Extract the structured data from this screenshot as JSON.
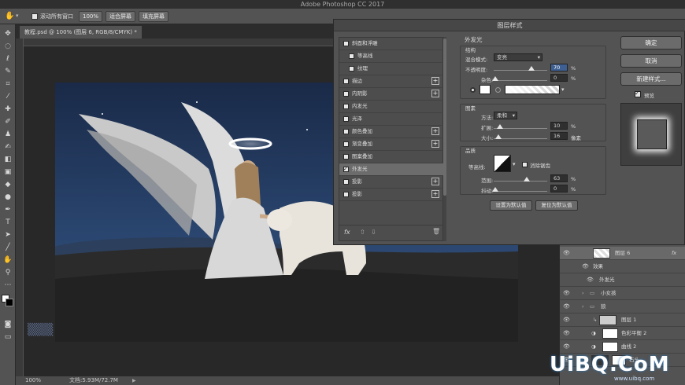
{
  "app": {
    "title": "Adobe Photoshop CC 2017"
  },
  "options_bar": {
    "scroll_all_windows": "滚动所有窗口",
    "zoom_100": "100%",
    "fit_screen": "适合屏幕",
    "fill_screen": "填充屏幕"
  },
  "document": {
    "tab_title": "教程.psd @ 100% (图层 6, RGB/8/CMYK) *",
    "zoom": "100%",
    "doc_size": "文档:5.93M/72.7M",
    "watermark": "UiBQ.CoM",
    "watermark_sub": "www.uibq.com"
  },
  "dialog": {
    "title": "图层样式",
    "styles": [
      {
        "label": "斜面和浮雕",
        "checked": false,
        "plus": false,
        "indent": false
      },
      {
        "label": "等高线",
        "checked": false,
        "plus": false,
        "indent": true
      },
      {
        "label": "纹理",
        "checked": false,
        "plus": false,
        "indent": true
      },
      {
        "label": "描边",
        "checked": false,
        "plus": true,
        "indent": false
      },
      {
        "label": "内阴影",
        "checked": false,
        "plus": true,
        "indent": false
      },
      {
        "label": "内发光",
        "checked": false,
        "plus": false,
        "indent": false
      },
      {
        "label": "光泽",
        "checked": false,
        "plus": false,
        "indent": false
      },
      {
        "label": "颜色叠加",
        "checked": false,
        "plus": true,
        "indent": false
      },
      {
        "label": "渐变叠加",
        "checked": false,
        "plus": true,
        "indent": false
      },
      {
        "label": "图案叠加",
        "checked": false,
        "plus": false,
        "indent": false
      },
      {
        "label": "外发光",
        "checked": true,
        "plus": false,
        "indent": false
      },
      {
        "label": "投影",
        "checked": false,
        "plus": true,
        "indent": false
      }
    ],
    "section_title": "外发光",
    "structure": {
      "title": "结构",
      "blend_mode_label": "混合模式:",
      "blend_mode_value": "变亮",
      "opacity_label": "不透明度:",
      "opacity_value": "70",
      "noise_label": "杂色:",
      "noise_value": "0",
      "percent": "%"
    },
    "elements": {
      "title": "图素",
      "method_label": "方法:",
      "method_value": "柔和",
      "spread_label": "扩展:",
      "spread_value": "10",
      "size_label": "大小:",
      "size_value": "16",
      "px": "像素",
      "percent": "%"
    },
    "quality": {
      "title": "品质",
      "contour_label": "等高线:",
      "anti_alias": "消除锯齿",
      "range_label": "范围:",
      "range_value": "63",
      "jitter_label": "抖动:",
      "jitter_value": "0",
      "percent": "%"
    },
    "set_default": "设置为默认值",
    "reset_default": "复位为默认值",
    "ok": "确定",
    "cancel": "取消",
    "new_style": "新建样式...",
    "preview": "预览",
    "fx": "fx"
  },
  "layers": [
    {
      "name": "图层 6",
      "fx": "fx",
      "kind": "layer"
    },
    {
      "name": "效果",
      "kind": "sub"
    },
    {
      "name": "外发光",
      "kind": "sub2"
    },
    {
      "name": "小女孩",
      "kind": "folder"
    },
    {
      "name": "狼",
      "kind": "folder"
    },
    {
      "name": "图层 1",
      "kind": "layer"
    },
    {
      "name": "色彩平衡 2",
      "kind": "adj"
    },
    {
      "name": "曲线 2",
      "kind": "adj"
    },
    {
      "name": "石头",
      "kind": "layer"
    }
  ]
}
